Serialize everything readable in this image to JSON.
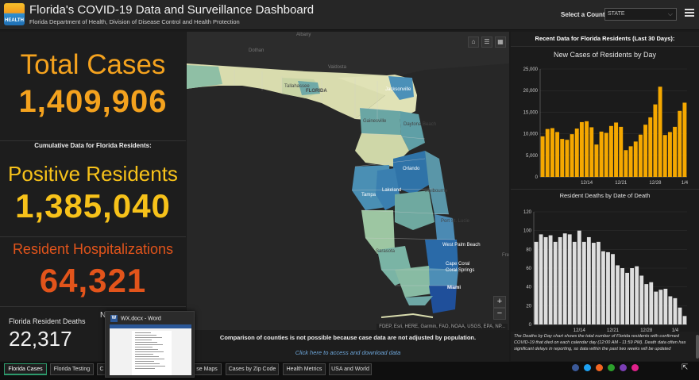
{
  "header": {
    "logo_text": "HEALTH",
    "title": "Florida's COVID-19 Data and Surveillance Dashboard",
    "subtitle": "Florida Department of Health, Division of Disease Control and Health Protection",
    "county_label": "Select a County",
    "county_value": "STATE"
  },
  "left": {
    "total_cases_label": "Total Cases",
    "total_cases_value": "1,409,906",
    "cumulative_label": "Cumulative Data for Florida Residents:",
    "positive_label": "Positive Residents",
    "positive_value": "1,385,040",
    "hosp_label": "Resident Hospitalizations",
    "hosp_value": "64,321",
    "deaths_label": "Florida Resident Deaths",
    "deaths_value": "22,317",
    "partial_char": "N"
  },
  "map": {
    "labels": [
      "Albany",
      "Dothan",
      "Valdosta",
      "Tallahassee",
      "FLORIDA",
      "Jacksonville",
      "Gainesville",
      "Daytona Beach",
      "Orlando",
      "Tampa",
      "Lakeland",
      "Melbourne",
      "Port St. Lucie",
      "West Palm Beach",
      "Sarasota",
      "Cape Coral",
      "Coral Springs",
      "Miami",
      "Fre"
    ],
    "attribution": "FDEP, Esri, HERE, Garmin, FAO, NOAA, USGS, EPA, NP...",
    "zoom_in": "+",
    "zoom_out": "−",
    "tools": [
      "⌂",
      "☰",
      "▦"
    ]
  },
  "map_footer": {
    "note": "Comparison of counties is not possible because case data are not adjusted by population.",
    "link": "Click here to access and download data"
  },
  "right": {
    "title": "Recent Data for Florida Residents (Last 30 Days):",
    "note": "The Deaths by Day chart shows the total number of Florida residents with confirmed COVID-19 that died on each calendar day (12:00 AM - 11:59 PM). Death data often has significant delays in reporting, so data within the past two weeks will be updated"
  },
  "chart_data": [
    {
      "type": "bar",
      "title": "New Cases of Residents by Day",
      "color": "#f5a800",
      "ylim": [
        0,
        25000
      ],
      "yticks": [
        "0",
        "5,000",
        "10,000",
        "15,000",
        "20,000",
        "25,000"
      ],
      "xticks": [
        "12/14",
        "12/21",
        "12/28",
        "1/4"
      ],
      "xtick_index": [
        9,
        16,
        23,
        29
      ],
      "values": [
        9400,
        11100,
        11300,
        10400,
        8800,
        8600,
        9900,
        11200,
        12700,
        12900,
        11500,
        7500,
        10500,
        10200,
        11800,
        12600,
        11600,
        6200,
        7100,
        8200,
        9800,
        12100,
        13800,
        16800,
        20900,
        9700,
        10400,
        11600,
        15300,
        17200
      ]
    },
    {
      "type": "bar",
      "title": "Resident Deaths by Date of Death",
      "color": "#dedede",
      "ylim": [
        0,
        120
      ],
      "yticks": [
        "0",
        "20",
        "40",
        "60",
        "80",
        "100",
        "120"
      ],
      "xticks": [
        "12/14",
        "12/21",
        "12/28",
        "1/4"
      ],
      "xtick_index": [
        9,
        16,
        23,
        29
      ],
      "values": [
        88,
        96,
        93,
        95,
        88,
        93,
        97,
        96,
        88,
        100,
        88,
        93,
        87,
        88,
        78,
        77,
        75,
        63,
        60,
        55,
        60,
        62,
        52,
        43,
        45,
        35,
        37,
        38,
        30,
        28,
        18,
        9
      ]
    }
  ],
  "tabs": [
    {
      "label": "Florida Cases",
      "active": true
    },
    {
      "label": "Florida Testing",
      "active": false
    },
    {
      "label": "C",
      "active": false
    },
    {
      "label": "se Maps",
      "active": false
    },
    {
      "label": "Cases by Zip Code",
      "active": false
    },
    {
      "label": "Health Metrics",
      "active": false
    },
    {
      "label": "USA and World",
      "active": false
    }
  ],
  "socials": [
    {
      "icon": "facebook-icon",
      "color": "#3b5998"
    },
    {
      "icon": "twitter-icon",
      "color": "#1da1f2"
    },
    {
      "icon": "rss-icon",
      "color": "#f26522"
    },
    {
      "icon": "share-icon",
      "color": "#2ca02c"
    },
    {
      "icon": "email-icon",
      "color": "#7b3fb4"
    },
    {
      "icon": "link-icon",
      "color": "#e0218a"
    }
  ],
  "popup": {
    "title": "WX.docx - Word",
    "app_letter": "W"
  }
}
